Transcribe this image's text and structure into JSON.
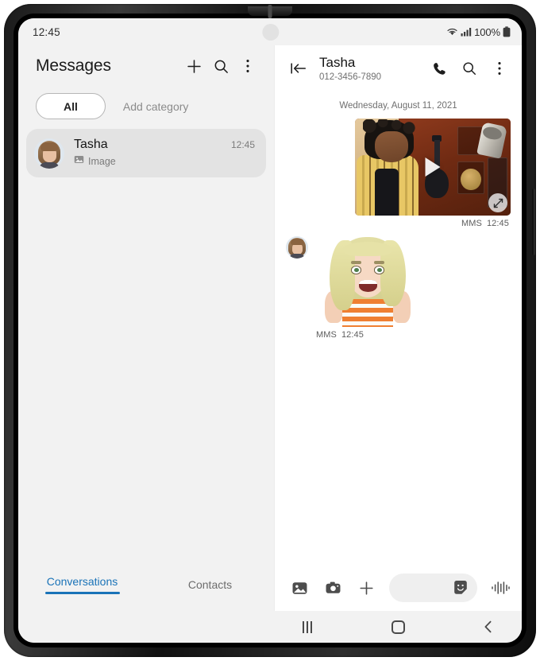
{
  "device": {
    "type": "foldable-phone",
    "frame_color": "#1b1b1b"
  },
  "status_bar": {
    "time": "12:45",
    "battery_percent": "100%",
    "icons": [
      "wifi-icon",
      "signal-icon",
      "battery-icon"
    ]
  },
  "left_pane": {
    "title": "Messages",
    "header_icons": [
      "plus-icon",
      "search-icon",
      "more-options-icon"
    ],
    "chips": [
      {
        "label": "All",
        "selected": true
      },
      {
        "label": "Add category",
        "selected": false
      }
    ],
    "conversations": [
      {
        "name": "Tasha",
        "preview_icon": "image-icon",
        "preview": "Image",
        "time": "12:45",
        "avatar": "avatar"
      }
    ],
    "bottom_tabs": [
      {
        "label": "Conversations",
        "active": true
      },
      {
        "label": "Contacts",
        "active": false
      }
    ],
    "accent_color": "#1a73b8"
  },
  "right_pane": {
    "header": {
      "collapse_icon": "collapse-panel-icon",
      "name": "Tasha",
      "phone": "012-3456-7890",
      "icons": [
        "call-icon",
        "search-icon",
        "more-options-icon"
      ]
    },
    "date_separator": "Wednesday, August 11, 2021",
    "messages": [
      {
        "direction": "outgoing",
        "type": "video",
        "meta_kind": "MMS",
        "meta_time": "12:45",
        "description": "Video thumbnail of a singer in a recording studio with microphone and guitars",
        "has_play_button": true,
        "has_expand_button": true
      },
      {
        "direction": "incoming",
        "type": "sticker",
        "meta_kind": "MMS",
        "meta_time": "12:45",
        "description": "AR emoji sticker of a blonde woman giving two thumbs up in an orange striped top"
      }
    ],
    "composer": {
      "icons": [
        "gallery-icon",
        "camera-icon",
        "plus-icon"
      ],
      "input_value": "",
      "input_placeholder": "",
      "sticker_icon": "sticker-icon",
      "voice_icon": "voice-waveform-icon"
    }
  },
  "nav_bar": {
    "buttons": [
      "recents-icon",
      "home-icon",
      "back-icon"
    ]
  }
}
